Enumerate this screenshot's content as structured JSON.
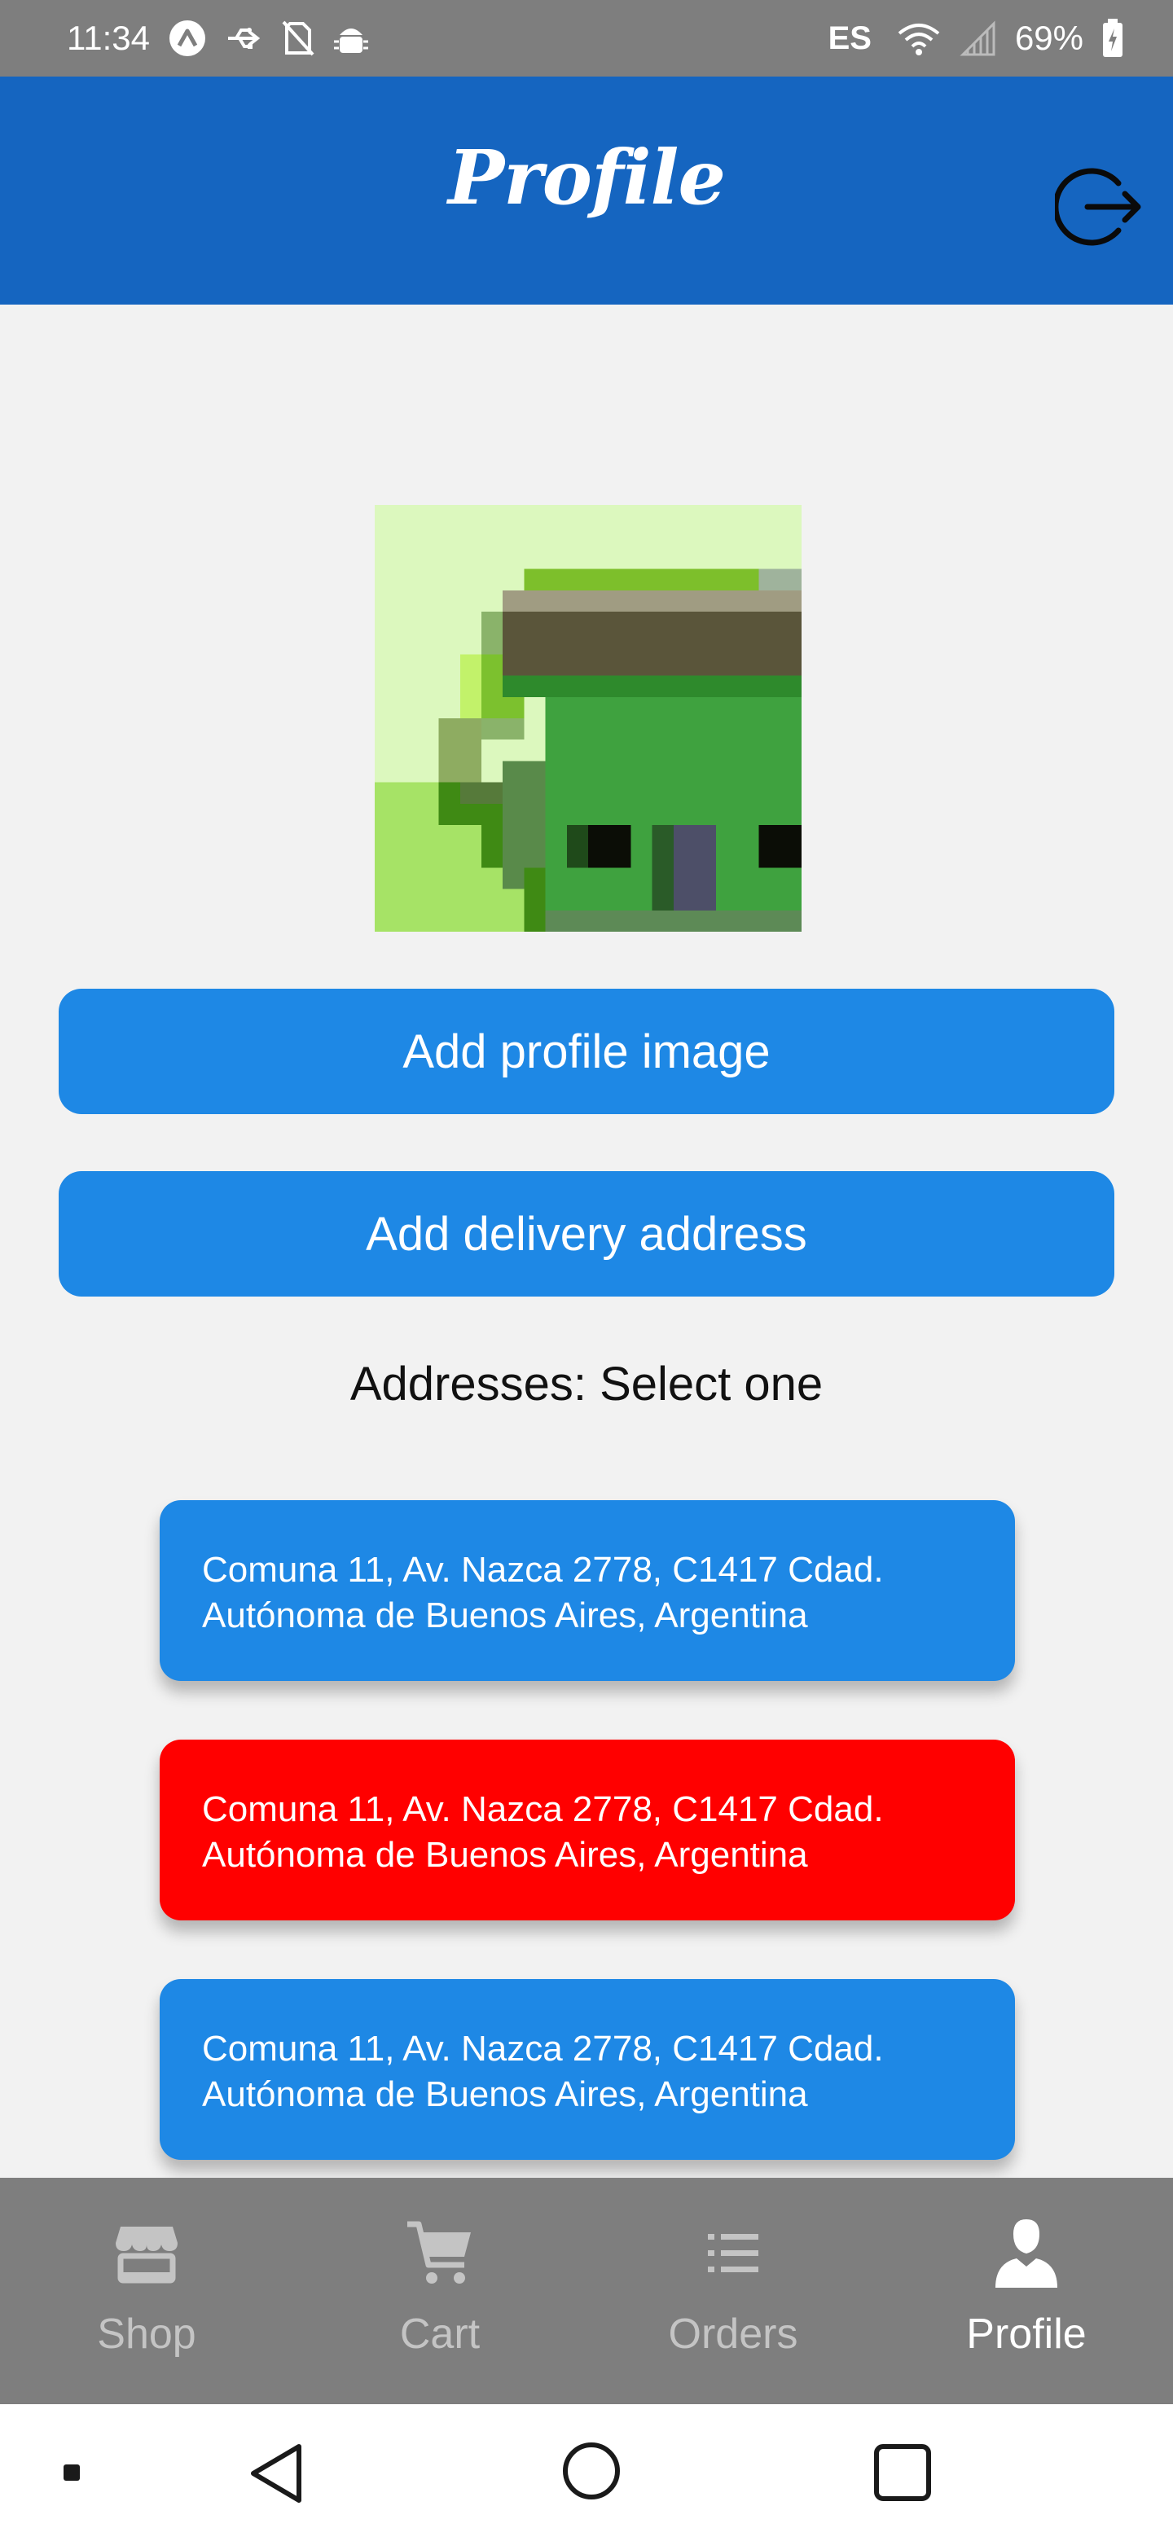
{
  "status_bar": {
    "time": "11:34",
    "language": "ES",
    "battery": "69%",
    "icons": [
      "expo-icon",
      "usb-icon",
      "no-sim-icon",
      "android-debug-icon",
      "wifi-icon",
      "signal-icon",
      "battery-icon"
    ]
  },
  "header": {
    "title": "Profile",
    "logout_icon": "logout-icon"
  },
  "profile": {
    "image_description_icon": "pixel-house-avatar",
    "add_image_label": "Add profile image",
    "add_address_label": "Add delivery address",
    "addresses_title": "Addresses: Select one"
  },
  "addresses": [
    {
      "line1": "Comuna 11, Av. Nazca 2778, C1417 Cdad.",
      "line2": "Autónoma de Buenos Aires, Argentina",
      "selected": false
    },
    {
      "line1": "Comuna 11, Av. Nazca 2778, C1417 Cdad.",
      "line2": "Autónoma de Buenos Aires, Argentina",
      "selected": true
    },
    {
      "line1": "Comuna 11, Av. Nazca 2778, C1417 Cdad.",
      "line2": "Autónoma de Buenos Aires, Argentina",
      "selected": false
    }
  ],
  "tabs": [
    {
      "label": "Shop",
      "icon": "store-icon",
      "active": false
    },
    {
      "label": "Cart",
      "icon": "cart-icon",
      "active": false
    },
    {
      "label": "Orders",
      "icon": "list-icon",
      "active": false
    },
    {
      "label": "Profile",
      "icon": "person-icon",
      "active": true
    }
  ],
  "colors": {
    "header": "#1565c0",
    "button": "#1e88e5",
    "selected_address": "#ff0000",
    "tab_bar": "#7e7e7e",
    "status_bar": "#7e7e7e"
  }
}
